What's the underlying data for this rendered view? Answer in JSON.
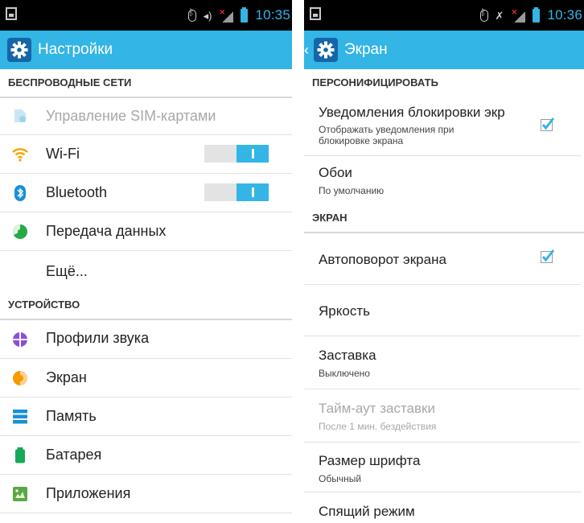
{
  "left": {
    "status": {
      "time": "10:35"
    },
    "header": {
      "title": "Настройки"
    },
    "sections": {
      "wireless": "БЕСПРОВОДНЫЕ СЕТИ",
      "device": "УСТРОЙСТВО"
    },
    "items": {
      "sim": "Управление SIM-картами",
      "wifi": "Wi-Fi",
      "bluetooth": "Bluetooth",
      "data": "Передача данных",
      "more": "Ещё...",
      "sound": "Профили звука",
      "display": "Экран",
      "storage": "Память",
      "battery": "Батарея",
      "apps": "Приложения"
    },
    "toggles": {
      "wifi_on": true,
      "bluetooth_on": true
    }
  },
  "right": {
    "status": {
      "time": "10:36"
    },
    "header": {
      "title": "Экран"
    },
    "sections": {
      "personalize": "ПЕРСОНИФИЦИРОВАТЬ",
      "screen": "ЭКРАН"
    },
    "items": {
      "lock_notifications": {
        "title": "Уведомления блокировки экр",
        "summary": "Отображать уведомления при блокировке экрана",
        "checked": true
      },
      "wallpaper": {
        "title": "Обои",
        "summary": "По умолчанию"
      },
      "autorotate": {
        "title": "Автоповорот экрана",
        "checked": true
      },
      "brightness": {
        "title": "Яркость"
      },
      "screensaver": {
        "title": "Заставка",
        "summary": "Выключено"
      },
      "screensaver_timeout": {
        "title": "Тайм-аут заставки",
        "summary": "После 1 мин. бездействия"
      },
      "font_size": {
        "title": "Размер шрифта",
        "summary": "Обычный"
      },
      "sleep": {
        "title": "Спящий режим"
      }
    }
  },
  "colors": {
    "accent": "#33b5e5",
    "statusbar": "#000000"
  },
  "icons": [
    "gear-icon",
    "sim-icon",
    "wifi-icon",
    "bluetooth-icon",
    "data-usage-icon",
    "sound-profiles-icon",
    "display-icon",
    "storage-icon",
    "battery-icon",
    "apps-icon",
    "checkbox-icon",
    "back-caret-icon"
  ]
}
